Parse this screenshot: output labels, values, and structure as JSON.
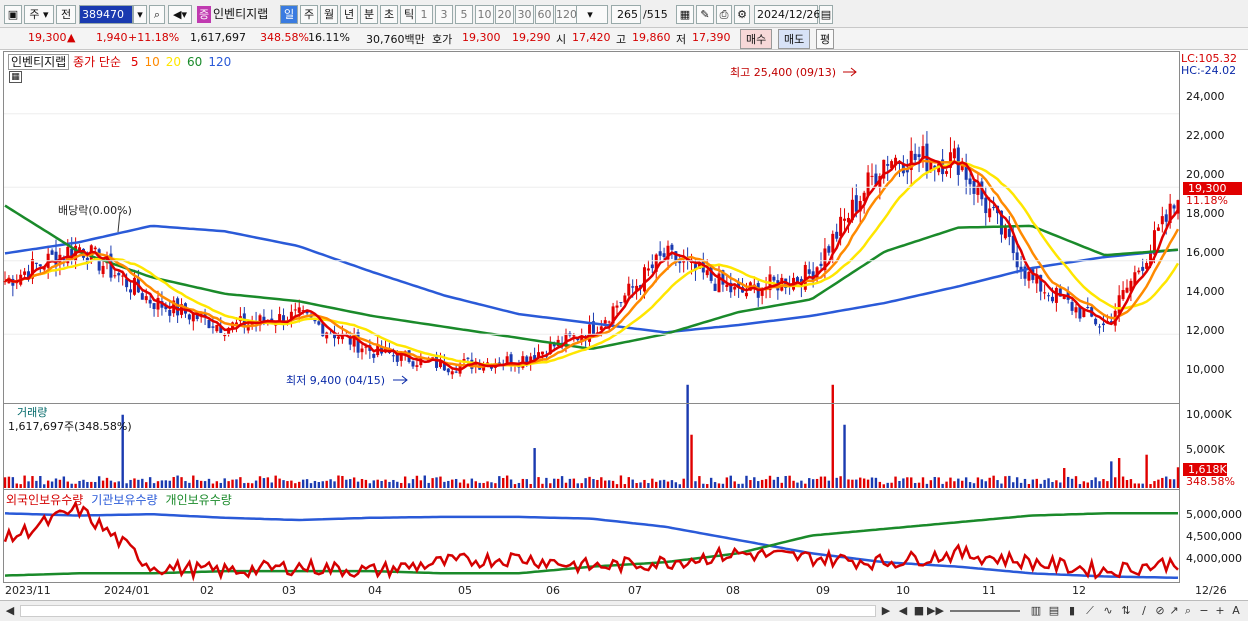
{
  "toolbar": {
    "type_select": "주",
    "mode_select": "전",
    "code": "389470",
    "search_icon": "search-icon",
    "market_badge": "증",
    "name": "인벤티지랩",
    "period_tabs": [
      "일",
      "주",
      "월",
      "년",
      "분",
      "초",
      "틱"
    ],
    "interval_buttons": [
      "1",
      "3",
      "5",
      "10",
      "20",
      "30",
      "60",
      "120"
    ],
    "page_current": "265",
    "page_total": "/515",
    "date": "2024/12/26"
  },
  "quote": {
    "price": "19,300",
    "updown_mark": "▲",
    "change": "1,940",
    "change_pct": "+11.18%",
    "volume": "1,617,697",
    "volume_ratio": "348.58%",
    "turnover": "16.11%",
    "amount": "30,760백만",
    "bid_label": "호가",
    "bid1": "19,300",
    "bid2": "19,290",
    "open_label": "시",
    "open": "17,420",
    "high_label": "고",
    "high": "19,860",
    "low_label": "저",
    "low": "17,390",
    "buy_button": "매수",
    "sell_button": "매도",
    "avg_button": "평"
  },
  "price_panel": {
    "title": "인벤티지랩",
    "ma_label": "종가 단순",
    "ma_periods": [
      "5",
      "10",
      "20",
      "60",
      "120"
    ],
    "high_annotation": "최고 25,400 (09/13)",
    "low_annotation": "최저 9,400 (04/15)",
    "dividend_annotation": "배당락(0.00%)",
    "lc": "LC:105.32",
    "hc": "HC:-24.02",
    "y_ticks": [
      "24,000",
      "22,000",
      "20,000",
      "18,000",
      "16,000",
      "14,000",
      "12,000",
      "10,000"
    ],
    "current_price_tag": "19,300",
    "current_pct_tag": "11.18%"
  },
  "volume_panel": {
    "title": "거래량",
    "info": "1,617,697주(348.58%)",
    "y_ticks": [
      "10,000K",
      "5,000K"
    ],
    "current_tag": "1,618K",
    "current_pct": "348.58%"
  },
  "holding_panel": {
    "legend": [
      "외국인보유수량",
      "기관보유수량",
      "개인보유수량"
    ],
    "y_ticks": [
      "5,000,000",
      "4,500,000",
      "4,000,000"
    ]
  },
  "x_labels": [
    "2023/11",
    "2024/01",
    "02",
    "03",
    "04",
    "05",
    "06",
    "07",
    "08",
    "09",
    "10",
    "11",
    "12",
    "12/26"
  ],
  "colors": {
    "ma5": "#e00000",
    "ma10": "#ff8a00",
    "ma20": "#ffe600",
    "ma60": "#1a8a2a",
    "ma120": "#2a5ad8",
    "up": "#e00000",
    "down": "#1a3ab0"
  },
  "chart_data": {
    "type": "line",
    "x_start": "2023/11",
    "x_end": "2024/12/26",
    "series": [
      {
        "name": "120",
        "values": [
          16400,
          17000,
          17900,
          17600,
          16800,
          15400,
          14100,
          13100,
          12600,
          12100,
          12500,
          13000,
          13700,
          14600,
          15600,
          16200,
          16600
        ]
      },
      {
        "name": "60",
        "values": [
          19000,
          16500,
          15100,
          14200,
          13800,
          13000,
          12400,
          11800,
          11200,
          12000,
          13200,
          13900,
          16500,
          17800,
          17900,
          16300,
          16600
        ]
      },
      {
        "name": "5",
        "values": [
          14900,
          16800,
          13800,
          12400,
          13000,
          11100,
          10300,
          10600,
          12200,
          16300,
          14200,
          15300,
          21600,
          21500,
          14900,
          12400,
          19300
        ]
      }
    ],
    "y_axis": {
      "min": 9400,
      "max": 25400
    }
  }
}
